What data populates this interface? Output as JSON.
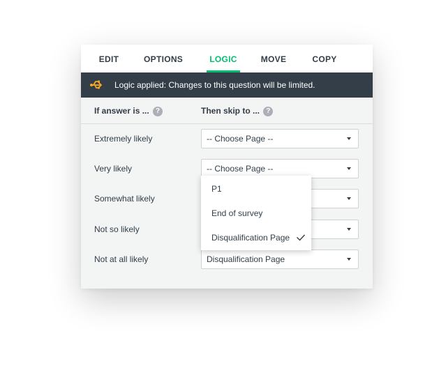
{
  "tabs": [
    {
      "label": "EDIT",
      "active": false
    },
    {
      "label": "OPTIONS",
      "active": false
    },
    {
      "label": "LOGIC",
      "active": true
    },
    {
      "label": "MOVE",
      "active": false
    },
    {
      "label": "COPY",
      "active": false
    }
  ],
  "banner": {
    "text": "Logic applied: Changes to this question will be limited.",
    "icon": "usb-logic-icon",
    "icon_color": "#f5a623"
  },
  "columns": {
    "answer": "If answer is ...",
    "skip": "Then skip to ...",
    "help_icon": "?"
  },
  "rows": [
    {
      "label": "Extremely likely",
      "select_value": "-- Choose Page --"
    },
    {
      "label": "Very likely",
      "select_value": "-- Choose Page --"
    },
    {
      "label": "Somewhat likely",
      "select_value": ""
    },
    {
      "label": "Not so likely",
      "select_value": ""
    },
    {
      "label": "Not at all likely",
      "select_value": "Disqualification Page"
    }
  ],
  "dropdown": {
    "options": [
      "P1",
      "End of survey",
      "Disqualification Page"
    ],
    "selected": "Disqualification Page"
  },
  "colors": {
    "accent": "#00bf6f",
    "banner_bg": "#333e48",
    "text": "#333e48"
  }
}
